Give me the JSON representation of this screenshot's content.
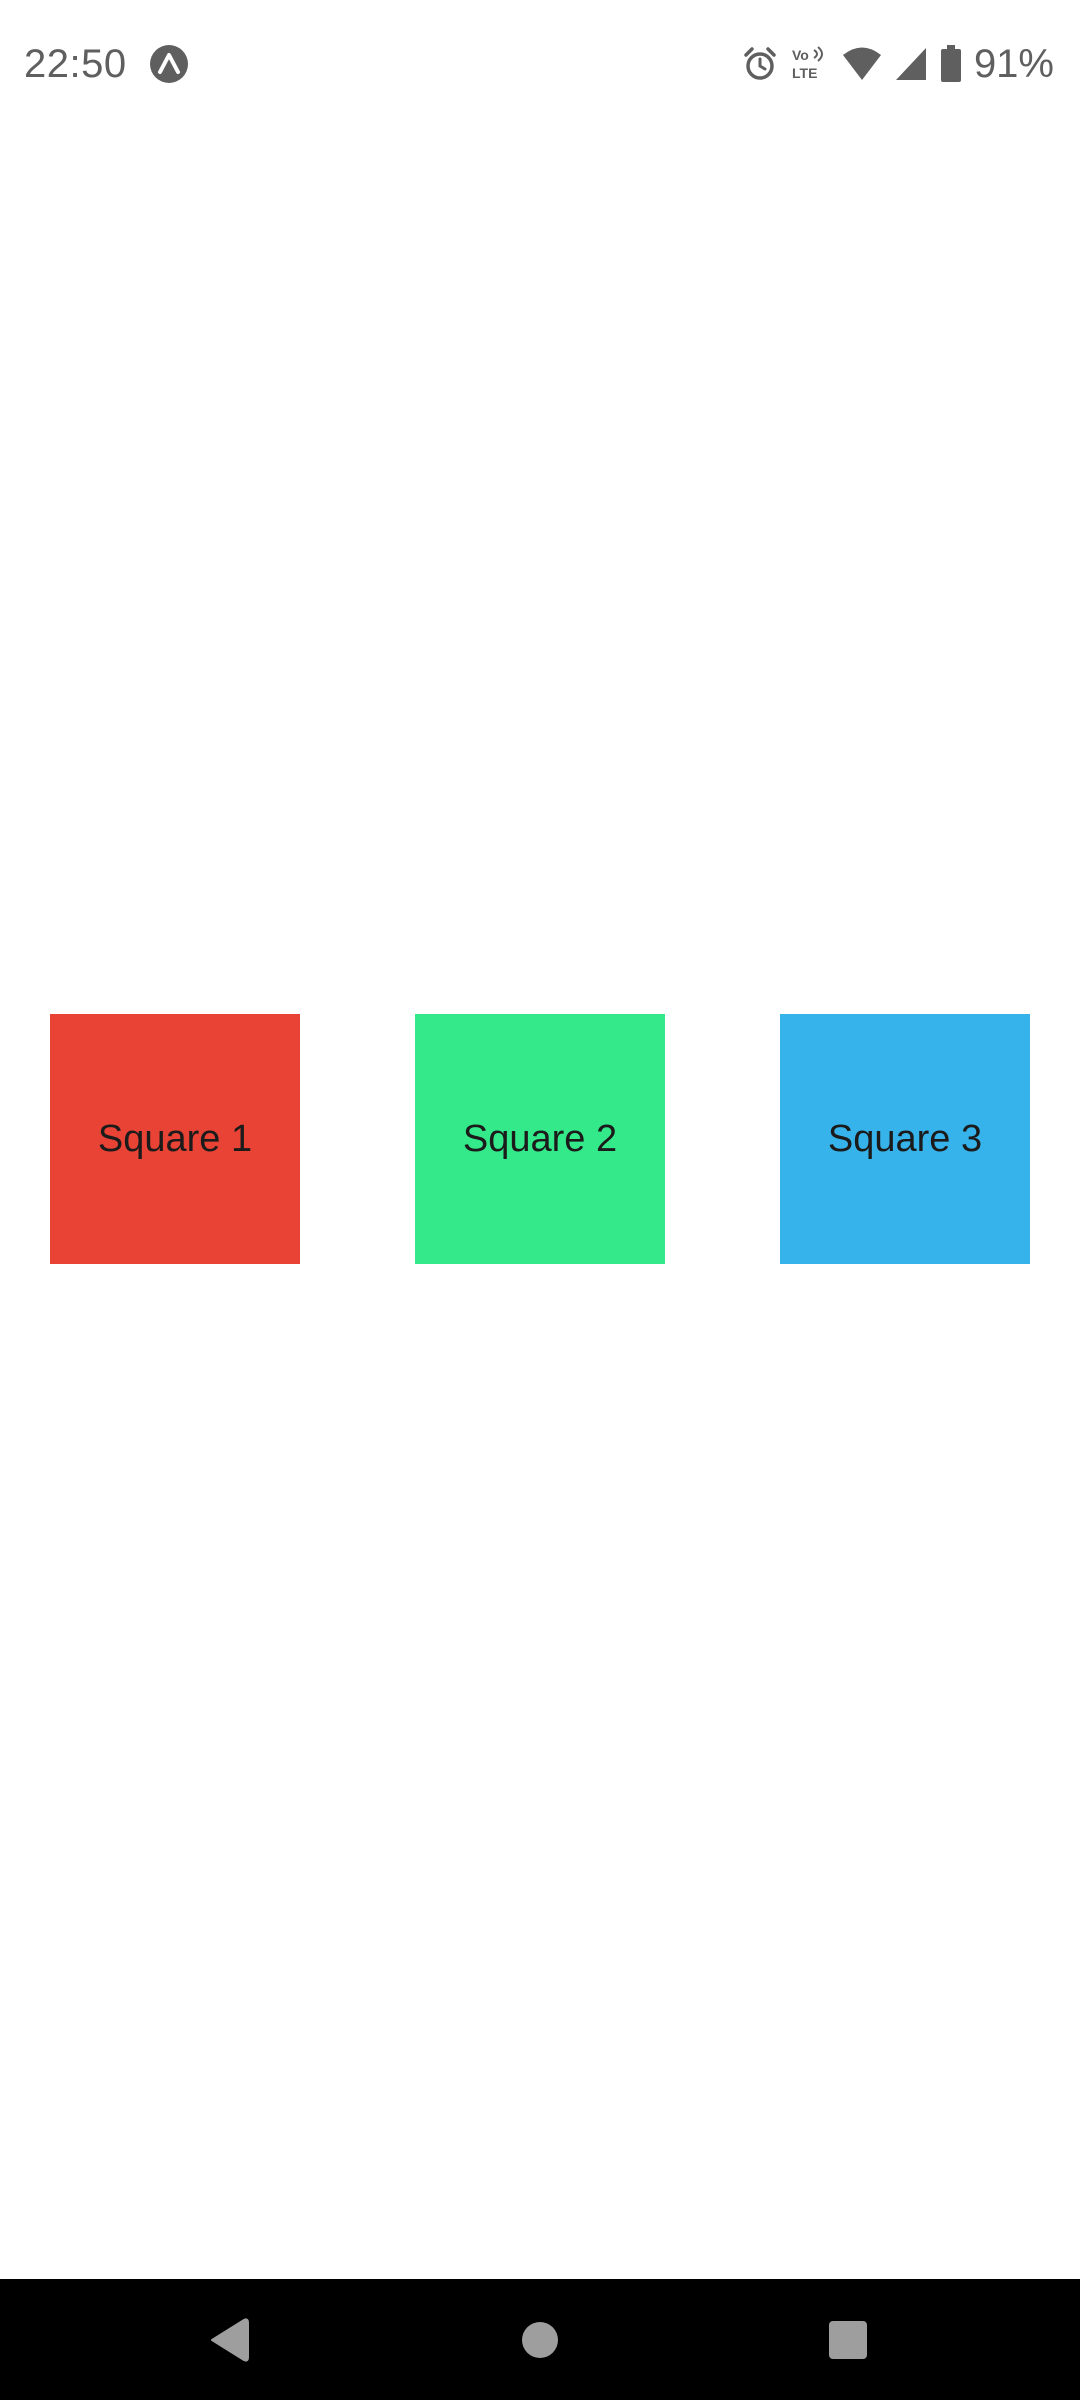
{
  "status_bar": {
    "time": "22:50",
    "app_icon": "expo-icon",
    "icons": [
      "alarm-icon",
      "volte-icon",
      "wifi-icon",
      "cell-signal-icon",
      "battery-icon"
    ],
    "volte_label_top": "Vo",
    "volte_label_bottom": "LTE",
    "battery_percent": "91%"
  },
  "squares": [
    {
      "label": "Square 1",
      "color": "#e94336"
    },
    {
      "label": "Square 2",
      "color": "#34e98a"
    },
    {
      "label": "Square 3",
      "color": "#36b3ea"
    }
  ],
  "nav_bar": {
    "buttons": [
      "back-icon",
      "home-icon",
      "recents-icon"
    ],
    "background": "#000000"
  }
}
